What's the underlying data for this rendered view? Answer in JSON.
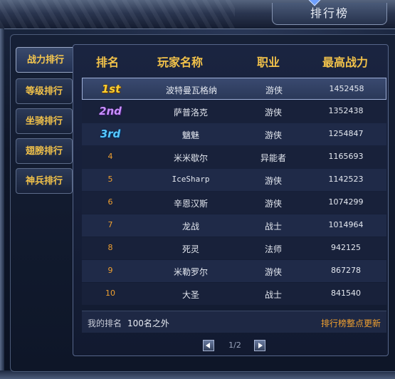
{
  "window": {
    "title": "排行榜"
  },
  "tabs": [
    {
      "label": "战力排行",
      "active": true
    },
    {
      "label": "等级排行",
      "active": false
    },
    {
      "label": "坐骑排行",
      "active": false
    },
    {
      "label": "翅膀排行",
      "active": false
    },
    {
      "label": "神兵排行",
      "active": false
    }
  ],
  "table": {
    "columns": [
      "排名",
      "玩家名称",
      "职业",
      "最高战力"
    ],
    "rows": [
      {
        "rank": "1st",
        "name": "波特曼瓦格纳",
        "job": "游侠",
        "power": "1452458"
      },
      {
        "rank": "2nd",
        "name": "萨普洛克",
        "job": "游侠",
        "power": "1352438"
      },
      {
        "rank": "3rd",
        "name": "魑魅",
        "job": "游侠",
        "power": "1254847"
      },
      {
        "rank": "4",
        "name": "米米歇尔",
        "job": "异能者",
        "power": "1165693"
      },
      {
        "rank": "5",
        "name": "IceSharp",
        "job": "游侠",
        "power": "1142523"
      },
      {
        "rank": "6",
        "name": "辛恩汉斯",
        "job": "游侠",
        "power": "1074299"
      },
      {
        "rank": "7",
        "name": "龙战",
        "job": "战士",
        "power": "1014964"
      },
      {
        "rank": "8",
        "name": "死灵",
        "job": "法师",
        "power": "942125"
      },
      {
        "rank": "9",
        "name": "米勒罗尔",
        "job": "游侠",
        "power": "867278"
      },
      {
        "rank": "10",
        "name": "大圣",
        "job": "战士",
        "power": "841540"
      }
    ]
  },
  "footer": {
    "my_rank_label": "我的排名",
    "my_rank_value": "100名之外",
    "update_note": "排行榜整点更新"
  },
  "pager": {
    "text": "1/2"
  },
  "colors": {
    "accent_gold": "#f2c24a",
    "rank_orange": "#f0a030",
    "panel_bg": "#1a2440"
  }
}
